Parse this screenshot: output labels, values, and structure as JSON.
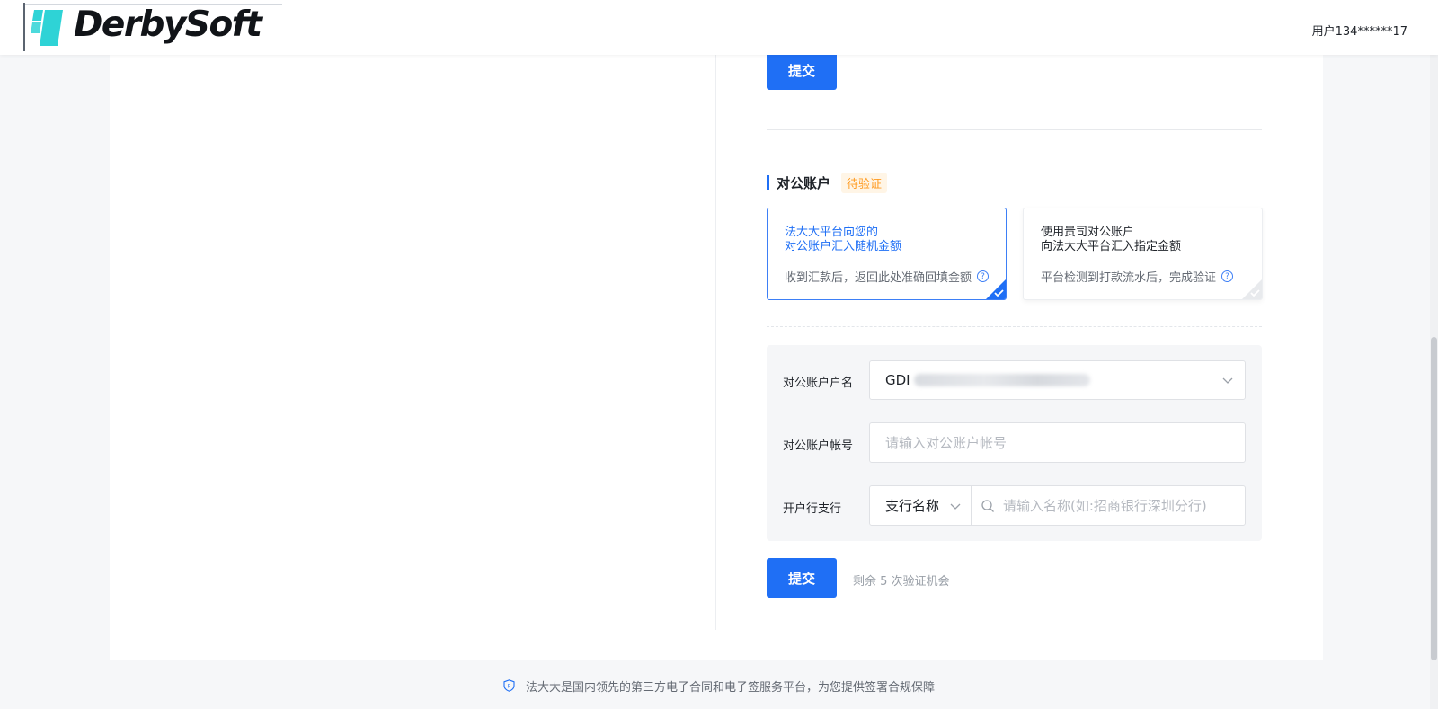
{
  "header": {
    "logo_text": "DerbySoft",
    "user_name": "用户134******17"
  },
  "top_submit_label": "提交",
  "section": {
    "title": "对公账户",
    "status_badge": "待验证"
  },
  "options": [
    {
      "title_line1": "法大大平台向您的",
      "title_line2": "对公账户汇入随机金额",
      "description": "收到汇款后，返回此处准确回填金额",
      "selected": true
    },
    {
      "title_line1": "使用贵司对公账户",
      "title_line2": "向法大大平台汇入指定金额",
      "description": "平台检测到打款流水后，完成验证",
      "selected": false
    }
  ],
  "form": {
    "account_name_label": "对公账户户名",
    "account_name_value": "GDI",
    "account_number_label": "对公账户帐号",
    "account_number_placeholder": "请输入对公账户帐号",
    "bank_branch_label": "开户行支行",
    "branch_type_value": "支行名称",
    "branch_search_placeholder": "请输入名称(如:招商银行深圳分行)"
  },
  "bottom_submit_label": "提交",
  "attempts_text": "剩余 5 次验证机会",
  "footer_text": "法大大是国内领先的第三方电子合同和电子签服务平台，为您提供签署合规保障",
  "colors": {
    "primary": "#1f6ff5",
    "badge_text": "#ff9a1f",
    "badge_bg": "#fff5e6",
    "logo_accent": "#2ed3d6"
  }
}
